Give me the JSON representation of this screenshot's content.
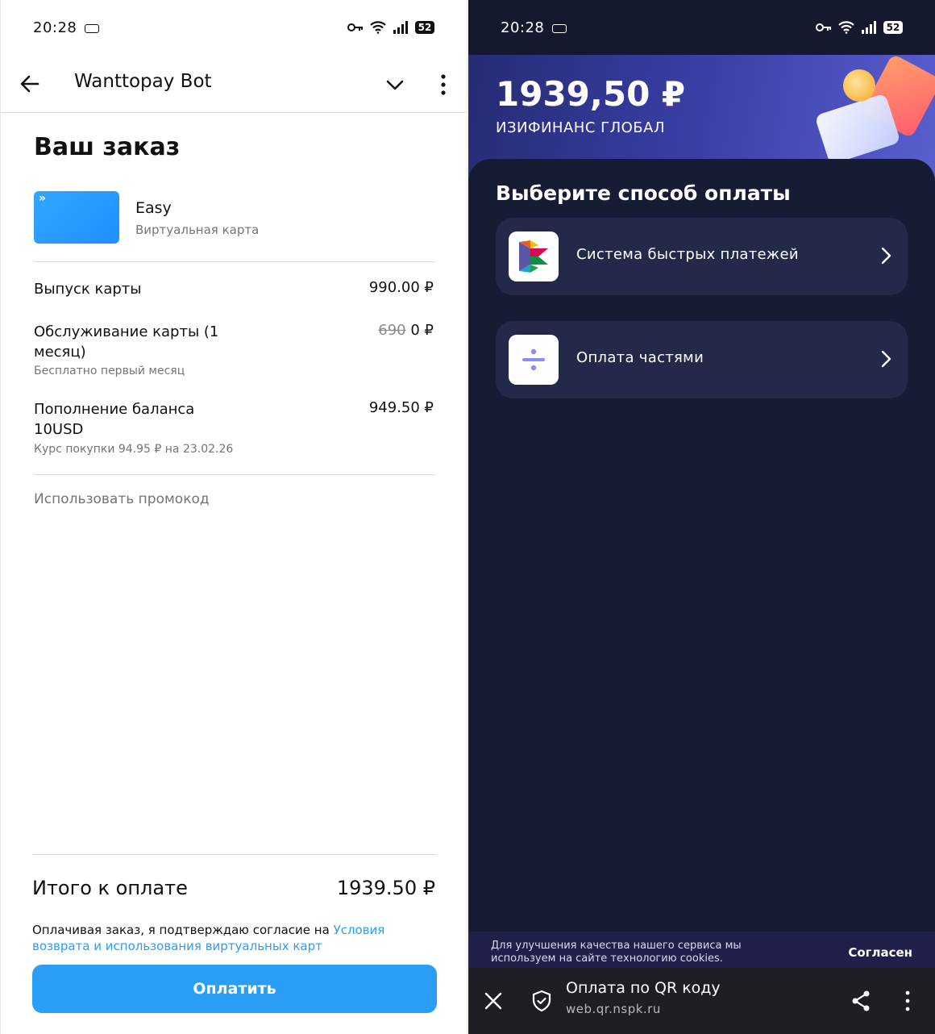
{
  "left": {
    "status": {
      "time": "20:28",
      "battery": "52"
    },
    "header": {
      "title": "Wanttopay Bot"
    },
    "order_title": "Ваш заказ",
    "product": {
      "name": "Easy",
      "subtitle": "Виртуальная карта",
      "thumb_glyph": "»"
    },
    "items": [
      {
        "label": "Выпуск карты",
        "value": "990.00 ₽"
      },
      {
        "label": "Обслуживание карты (1 месяц)",
        "old_value": "690",
        "value": "0 ₽",
        "note": "Бесплатно первый месяц"
      },
      {
        "label": "Пополнение баланса 10USD",
        "value": "949.50 ₽",
        "note": "Курс покупки 94.95 ₽ на 23.02.26"
      }
    ],
    "promo": "Использовать промокод",
    "total": {
      "label": "Итого к оплате",
      "value": "1939.50 ₽"
    },
    "consent": {
      "text": "Оплачивая заказ, я подтверждаю согласие на ",
      "link": "Условия возврата и использования виртуальных карт"
    },
    "pay_button": "Оплатить"
  },
  "right": {
    "status": {
      "time": "20:28",
      "battery": "52"
    },
    "hero": {
      "amount": "1939,50 ₽",
      "merchant": "ИЗИФИНАНС ГЛОБАЛ"
    },
    "title": "Выберите способ оплаты",
    "options": [
      {
        "label": "Система быстрых платежей",
        "icon": "sbp-icon"
      },
      {
        "label": "Оплата частями",
        "icon": "divide-icon"
      }
    ],
    "cookie": {
      "text": "Для улучшения качества нашего сервиса мы используем на сайте технологию cookies.",
      "button": "Согласен"
    },
    "browser": {
      "title": "Оплата по QR коду",
      "url": "web.qr.nspk.ru"
    }
  },
  "colors": {
    "accent": "#2a9ef4",
    "dark_bg": "#171c35",
    "option_bg": "#232a49"
  }
}
